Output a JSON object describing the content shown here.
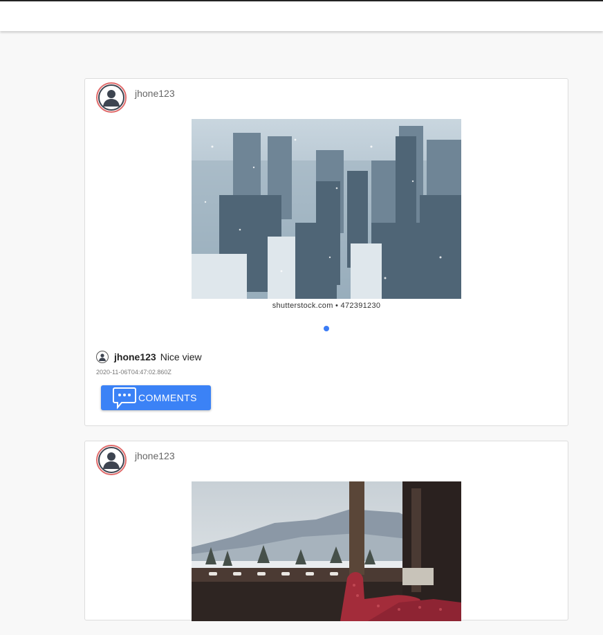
{
  "header": {},
  "posts": [
    {
      "username": "jhone123",
      "image": "snowy-city-skyline",
      "credit": "shutterstock.com • 472391230",
      "comment": {
        "user": "jhone123",
        "text": "Nice view"
      },
      "timestamp": "2020-11-06T04:47:02.860Z",
      "comments_button": "COMMENTS"
    },
    {
      "username": "jhone123",
      "image": "cozy-window-mountain-view"
    }
  ],
  "colors": {
    "accent": "#3b82f6",
    "avatar_ring": "#e06a6a",
    "carousel_dot": "#3b7cf5"
  }
}
